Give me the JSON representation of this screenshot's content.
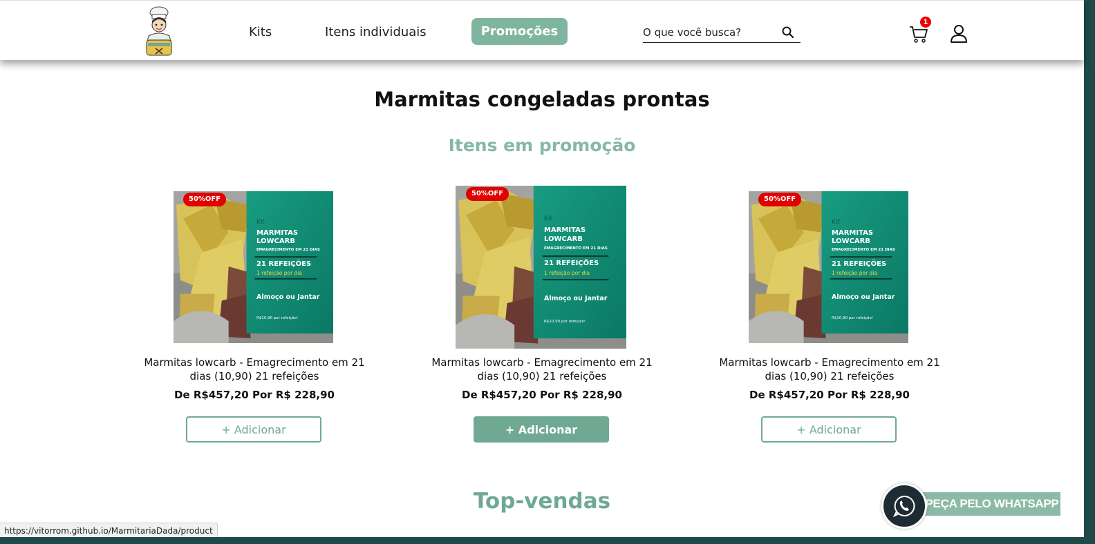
{
  "header": {
    "logo_alt": "Tempero com Amor",
    "nav": [
      {
        "label": "Kits"
      },
      {
        "label": "Itens individuais"
      },
      {
        "label": "Promoções"
      }
    ],
    "search": {
      "placeholder": "O que você busca?"
    },
    "cart_count": "1"
  },
  "main": {
    "title": "Marmitas congeladas prontas",
    "subtitle": "Itens em promoção",
    "products": [
      {
        "badge": "50%OFF",
        "kit_label": "Kit",
        "img_title_1": "MARMITAS",
        "img_title_2": "LOWCARB",
        "img_sub": "EMAGRECIMENTO EM 21 DIAS",
        "img_meals": "21 REFEIÇÕES",
        "img_per_day": "1 refeição por dia",
        "img_when": "Almoço ou Jantar",
        "img_price": "R$10,90 por refeição!",
        "name": "Marmitas lowcarb - Emagrecimento em 21 dias (10,90) 21 refeições",
        "price": "De R$457,20 Por R$ 228,90",
        "button": "+ Adicionar"
      },
      {
        "badge": "50%OFF",
        "kit_label": "Kit",
        "img_title_1": "MARMITAS",
        "img_title_2": "LOWCARB",
        "img_sub": "EMAGRECIMENTO EM 21 DIAS",
        "img_meals": "21 REFEIÇÕES",
        "img_per_day": "1 refeição por dia",
        "img_when": "Almoço ou Jantar",
        "img_price": "R$10,90 por refeição!",
        "name": "Marmitas lowcarb - Emagrecimento em 21 dias (10,90) 21 refeições",
        "price": "De R$457,20 Por R$ 228,90",
        "button": "+ Adicionar"
      },
      {
        "badge": "50%OFF",
        "kit_label": "Kit",
        "img_title_1": "MARMITAS",
        "img_title_2": "LOWCARB",
        "img_sub": "EMAGRECIMENTO EM 21 DIAS",
        "img_meals": "21 REFEIÇÕES",
        "img_per_day": "1 refeição por dia",
        "img_when": "Almoço ou Jantar",
        "img_price": "R$10,90 por refeição!",
        "name": "Marmitas lowcarb - Emagrecimento em 21 dias (10,90) 21 refeições",
        "price": "De R$457,20 Por R$ 228,90",
        "button": "+ Adicionar"
      }
    ],
    "section2_title": "Top-vendas"
  },
  "whatsapp": {
    "label": "PEÇA PELO WHATSAPP"
  },
  "status_bar": {
    "url": "https://vitorrom.github.io/MarmitariaDada/product"
  },
  "colors": {
    "accent": "#6fa993",
    "promo": "#7fb59e",
    "badge": "#e00000",
    "panel": "#0e8a72"
  }
}
